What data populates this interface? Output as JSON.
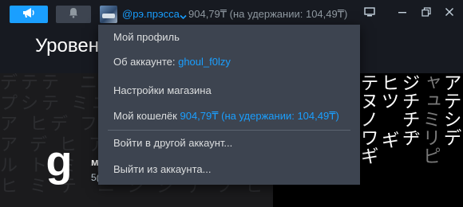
{
  "topbar": {
    "account_name": "@рэ.прэсса",
    "balance": "904,79₸ (на удержании: 104,49₸)"
  },
  "background": {
    "level_title": "Уровен",
    "profile_letter": "g",
    "profile_frag1": "м",
    "profile_frag2": "5("
  },
  "menu": {
    "profile": "Мой профиль",
    "about_label": "Об аккаунте: ",
    "about_value": "ghoul_f0lzy",
    "store_settings": "Настройки магазина",
    "wallet_label": "Мой кошелёк ",
    "wallet_value": "904,79₸ (на удержании: 104,49₸)",
    "switch_account": "Войти в другой аккаунт...",
    "sign_out": "Выйти из аккаунта..."
  },
  "colors": {
    "accent": "#1a9fff",
    "menu_bg": "#3d4450",
    "topbar_bg": "#171a21"
  },
  "icons": {
    "announce": "megaphone-icon",
    "bell": "bell-icon",
    "caret": "chevron-down-icon",
    "monitor": "monitor-icon",
    "minimize": "minimize-icon",
    "restore": "restore-icon",
    "close": "close-icon"
  }
}
